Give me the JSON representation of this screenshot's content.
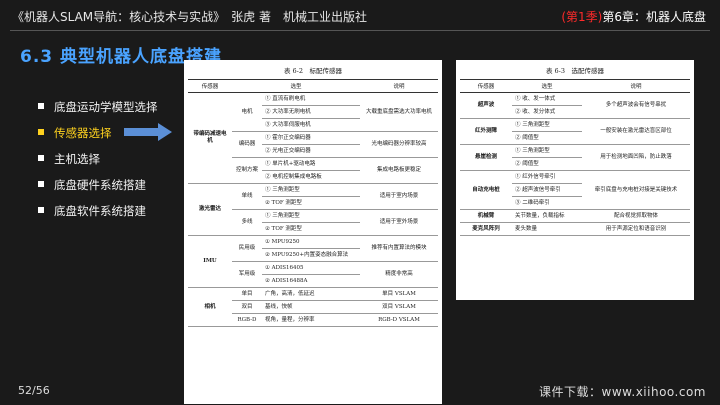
{
  "header": {
    "book": "《机器人SLAM导航：核心技术与实战》　张虎 著　机械工业出版社",
    "season": "(第1季)",
    "chapter": "第6章：机器人底盘"
  },
  "title": "6.3  典型机器人底盘搭建",
  "menu": [
    {
      "label": "底盘运动学模型选择",
      "active": false
    },
    {
      "label": "传感器选择",
      "active": true
    },
    {
      "label": "主机选择",
      "active": false
    },
    {
      "label": "底盘硬件系统搭建",
      "active": false
    },
    {
      "label": "底盘软件系统搭建",
      "active": false
    }
  ],
  "table1": {
    "caption": "表 6-2　标配传感器",
    "headers": [
      "传感器",
      "选型",
      "说明"
    ],
    "groups": [
      {
        "name": "带编码减速电机",
        "subs": [
          {
            "name": "电机",
            "opts": [
              "① 直流有刷电机",
              "② 大功率无刷电机",
              "③ 大功率伺服电机"
            ],
            "note": "大载重底盘需选大功率电机"
          },
          {
            "name": "编码器",
            "opts": [
              "① 霍尔正交编码器",
              "② 光电正交编码器"
            ],
            "note": "光电编码器分辨率较高"
          },
          {
            "name": "控制方案",
            "opts": [
              "① 单片机+驱动电路",
              "② 电机控制集成电路板"
            ],
            "note": "集成电路板更稳定"
          }
        ]
      },
      {
        "name": "激光雷达",
        "subs": [
          {
            "name": "单线",
            "opts": [
              "① 三角测距型",
              "② TOF 测距型"
            ],
            "note": "适用于室内场景"
          },
          {
            "name": "多线",
            "opts": [
              "① 三角测距型",
              "② TOF 测距型"
            ],
            "note": "适用于室外场景"
          }
        ]
      },
      {
        "name": "IMU",
        "subs": [
          {
            "name": "民用级",
            "opts": [
              "① MPU9250",
              "② MPU9250+内置姿态融合算法"
            ],
            "note": "推荐有内置算法的模块"
          },
          {
            "name": "军用级",
            "opts": [
              "① ADIS16405",
              "② ADIS16488A"
            ],
            "note": "精度非常高"
          }
        ]
      },
      {
        "name": "相机",
        "subs": [
          {
            "name": "单目",
            "opts": [
              "广角，高清，低延迟"
            ],
            "note": "单目 VSLAM"
          },
          {
            "name": "双目",
            "opts": [
              "基线，快帧"
            ],
            "note": "双目 VSLAM"
          },
          {
            "name": "RGB-D",
            "opts": [
              "视角，量程，分辨率"
            ],
            "note": "RGB-D VSLAM"
          }
        ]
      }
    ]
  },
  "table2": {
    "caption": "表 6-3　选配传感器",
    "headers": [
      "传感器",
      "选型",
      "说明"
    ],
    "rows": [
      {
        "name": "超声波",
        "opts": [
          "① 收、发一体式",
          "② 收、发分体式"
        ],
        "note": "多个超声波会有信号串扰"
      },
      {
        "name": "红外测障",
        "opts": [
          "① 三角测距型",
          "② 阈值型"
        ],
        "note": "一般安装在激光雷达盲区部位"
      },
      {
        "name": "悬崖检测",
        "opts": [
          "① 三角测距型",
          "② 阈值型"
        ],
        "note": "用于检测地面凹陷，防止跌落"
      },
      {
        "name": "自动充电桩",
        "opts": [
          "① 红外信号牵引",
          "② 超声波信号牵引",
          "③ 二维码牵引"
        ],
        "note": "牵引底盘与充电桩对接是关键技术"
      },
      {
        "name": "机械臂",
        "opts": [
          "关节数量，负载指标"
        ],
        "note": "配合视觉抓取物体"
      },
      {
        "name": "麦克风阵列",
        "opts": [
          "麦头数量"
        ],
        "note": "用于声源定位和语音识别"
      }
    ]
  },
  "footer": {
    "page": "52/56",
    "link": "课件下载：www.xiihoo.com"
  },
  "colors": {
    "background": "#1a1a1a",
    "title": "#4aa3ff",
    "active_item": "#ffd21f",
    "season": "#ff2a2a",
    "arrow": "#5b8fd6"
  }
}
